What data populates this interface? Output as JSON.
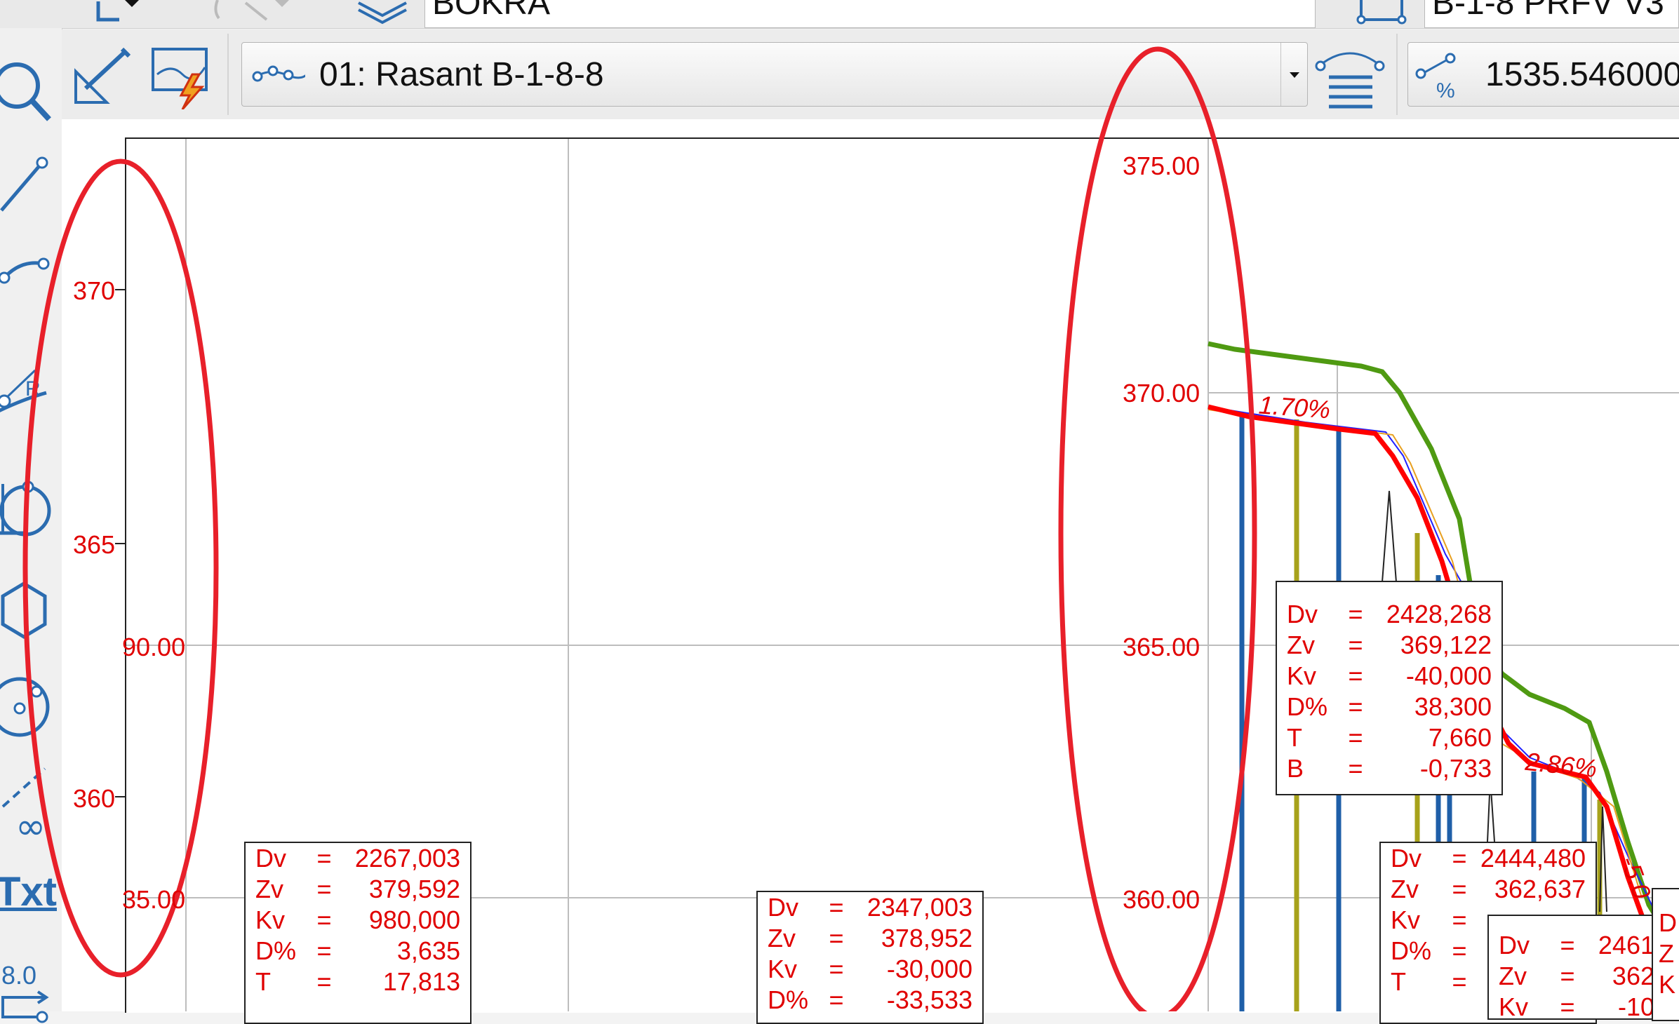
{
  "top_strip": {
    "layer_value": "BOKRA",
    "profile_value": "B-1-8 PRFV V3"
  },
  "toolbar": {
    "alignment_value": "01: Rasant B-1-8-8",
    "station_value": "1535.546000",
    "percent_symbol": "%"
  },
  "palette": {
    "arc_radius_letter": "R",
    "text_tool_label": "Txt",
    "dimension_tool_label": "8.0"
  },
  "left_axis": {
    "labels": [
      "370",
      "365",
      "360"
    ],
    "partial_labels": [
      "90.00",
      "35.00"
    ]
  },
  "right_axis": {
    "labels": [
      "375.00",
      "370.00",
      "365.00",
      "360.00"
    ]
  },
  "grade_labels": [
    "1.70%",
    "2.86%",
    "-5.0"
  ],
  "colors": {
    "annotation_red": "#e00000",
    "terrain_green": "#4f9a12",
    "profile_red": "#ff0000",
    "station_blue": "#1f5fa8",
    "station_olive": "#a7a21b",
    "thin_blue": "#2020ff",
    "thin_orange": "#e8a020"
  },
  "tags": [
    {
      "rows": [
        [
          "Dv",
          "=",
          "2267,003"
        ],
        [
          "Zv",
          "=",
          "379,592"
        ],
        [
          "Kv",
          "=",
          "980,000"
        ],
        [
          "D%",
          "=",
          "3,635"
        ],
        [
          "T",
          "=",
          "17,813"
        ]
      ]
    },
    {
      "rows": [
        [
          "Dv",
          "=",
          "2347,003"
        ],
        [
          "Zv",
          "=",
          "378,952"
        ],
        [
          "Kv",
          "=",
          "-30,000"
        ],
        [
          "D%",
          "=",
          "-33,533"
        ]
      ]
    },
    {
      "rows": [
        [
          "Dv",
          "=",
          "2428,268"
        ],
        [
          "Zv",
          "=",
          "369,122"
        ],
        [
          "Kv",
          "=",
          "-40,000"
        ],
        [
          "D%",
          "=",
          "38,300"
        ],
        [
          "T",
          "=",
          "7,660"
        ],
        [
          "B",
          "=",
          "-0,733"
        ]
      ]
    },
    {
      "rows": [
        [
          "Dv",
          "=",
          "2444,480"
        ],
        [
          "Zv",
          "=",
          "362,637"
        ],
        [
          "Kv",
          "=",
          ""
        ],
        [
          "D%",
          "=",
          ""
        ],
        [
          "T",
          "=",
          ""
        ]
      ]
    },
    {
      "rows": [
        [
          "Dv",
          "=",
          "2461"
        ],
        [
          "Zv",
          "=",
          "362"
        ],
        [
          "Kv",
          "=",
          "-10"
        ]
      ]
    },
    {
      "rows": [
        [
          "D",
          "",
          " "
        ],
        [
          "Z",
          "",
          " "
        ],
        [
          "K",
          "",
          " "
        ]
      ]
    }
  ]
}
